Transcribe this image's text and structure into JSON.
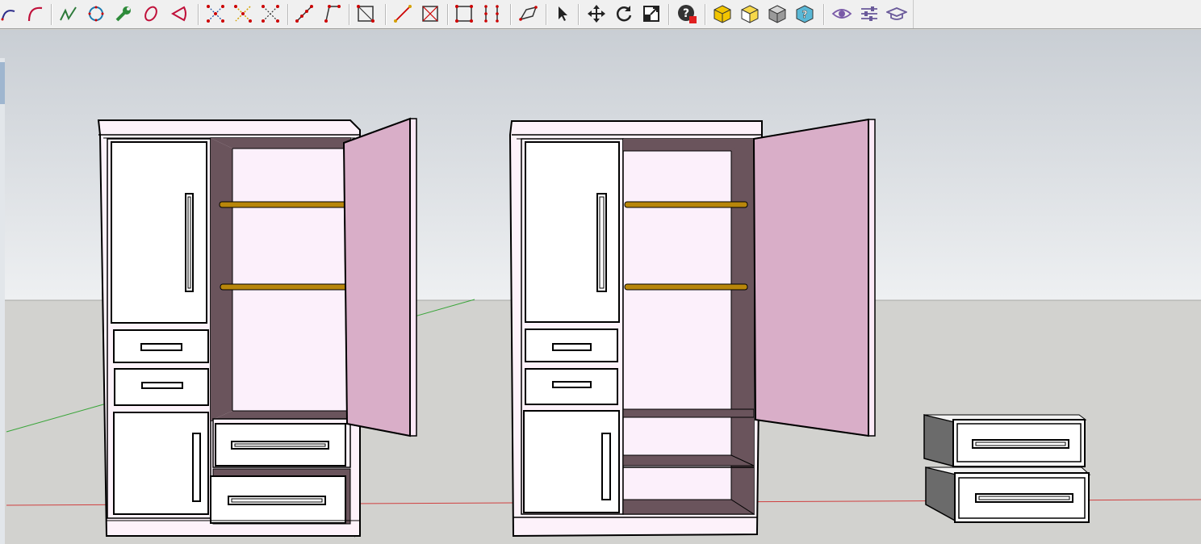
{
  "toolbar": {
    "tools": [
      {
        "id": "arc",
        "icon": "arc-icon"
      },
      {
        "id": "arc2",
        "icon": "two-point-arc-icon"
      },
      {
        "id": "freehand",
        "icon": "freehand-icon"
      },
      {
        "id": "polygon",
        "icon": "polygon-icon"
      },
      {
        "id": "wrench",
        "icon": "wrench-icon"
      },
      {
        "id": "ellipse",
        "icon": "ellipse-icon"
      },
      {
        "id": "sector",
        "icon": "sector-icon"
      },
      {
        "id": "explode",
        "icon": "explode-points-icon"
      },
      {
        "id": "implode",
        "icon": "collapse-points-icon"
      },
      {
        "id": "scatter",
        "icon": "scatter-points-icon"
      },
      {
        "id": "line-points",
        "icon": "line-points-icon"
      },
      {
        "id": "angle-points",
        "icon": "angle-points-icon"
      },
      {
        "id": "rect-diag",
        "icon": "rectangle-diagonal-icon"
      },
      {
        "id": "diag-line",
        "icon": "diagonal-line-icon"
      },
      {
        "id": "rect-cross",
        "icon": "rectangle-cross-icon"
      },
      {
        "id": "rect-corners",
        "icon": "rectangle-corners-icon"
      },
      {
        "id": "grid-points",
        "icon": "grid-points-icon"
      },
      {
        "id": "quad",
        "icon": "quadrilateral-icon"
      },
      {
        "id": "select",
        "icon": "select-arrow-icon"
      },
      {
        "id": "move",
        "icon": "move-icon"
      },
      {
        "id": "rotate",
        "icon": "rotate-icon"
      },
      {
        "id": "scale",
        "icon": "scale-icon"
      },
      {
        "id": "help",
        "icon": "help-icon"
      },
      {
        "id": "box-yellow",
        "icon": "component-box-icon"
      },
      {
        "id": "box-yellow-open",
        "icon": "component-open-icon"
      },
      {
        "id": "box-gray",
        "icon": "solid-box-icon"
      },
      {
        "id": "box-help",
        "icon": "box-help-icon"
      },
      {
        "id": "eye",
        "icon": "eye-icon"
      },
      {
        "id": "sliders",
        "icon": "sliders-icon"
      },
      {
        "id": "graduate",
        "icon": "graduation-cap-icon"
      }
    ]
  },
  "scene": {
    "sky_color": "#dde0e3",
    "ground_color": "#d2d2cf",
    "cabinet_body_color": "#fdf2fa",
    "cabinet_interior_color": "#6a545c",
    "door_color": "#d9aec8",
    "rod_color": "#b8860b",
    "axis_red": "#d04040",
    "axis_green": "#3aa53a"
  }
}
